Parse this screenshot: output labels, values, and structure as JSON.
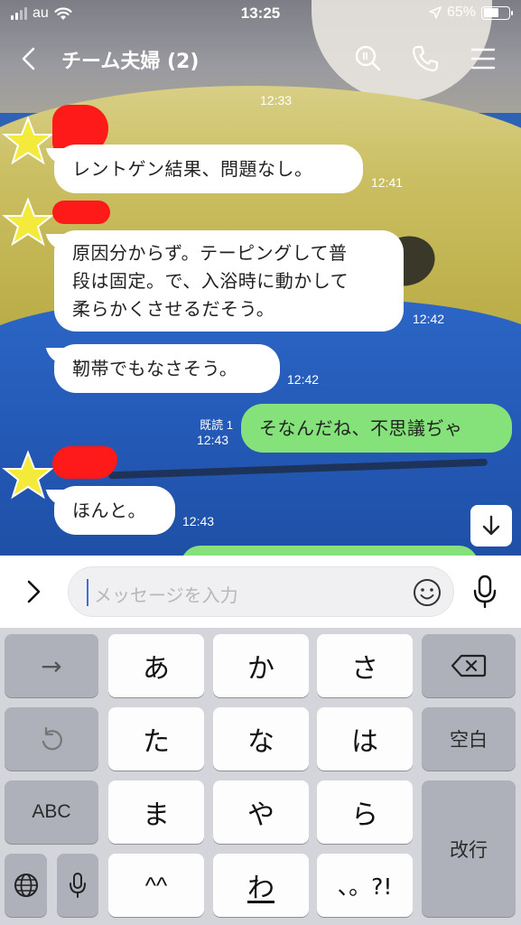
{
  "status_bar": {
    "carrier": "au",
    "time": "13:25",
    "battery_percent": "65%",
    "battery_level": 0.65
  },
  "header": {
    "title": "チーム夫婦 (2)"
  },
  "messages": [
    {
      "side": "in",
      "text": "レントゲン結果、問題なし。",
      "time": "12:41"
    },
    {
      "side": "in",
      "lines": [
        "原因分からず。テーピングして普",
        "段は固定。で、入浴時に動かして",
        "柔らかくさせるだそう。"
      ],
      "time": "12:42"
    },
    {
      "side": "in",
      "text": "靭帯でもなさそう。",
      "time": "12:42"
    },
    {
      "side": "out",
      "text": "そなんだね、不思議ぢゃ",
      "read": "既読 1",
      "time": "12:43"
    },
    {
      "side": "in",
      "text": "ほんと。",
      "time": "12:43"
    }
  ],
  "partial_time_top": "12:33",
  "input": {
    "placeholder": "メッセージを入力"
  },
  "keyboard": {
    "row1": [
      "→",
      "あ",
      "か",
      "さ"
    ],
    "row2": [
      "た",
      "な",
      "は",
      "空白"
    ],
    "row3": [
      "ABC",
      "ま",
      "や",
      "ら",
      "改行"
    ],
    "row4": [
      "^^",
      "わ",
      "、。?!"
    ]
  },
  "colors": {
    "incoming_bubble": "#ffffff",
    "outgoing_bubble": "#85e27a",
    "keyboard_bg": "#d4d5da"
  }
}
